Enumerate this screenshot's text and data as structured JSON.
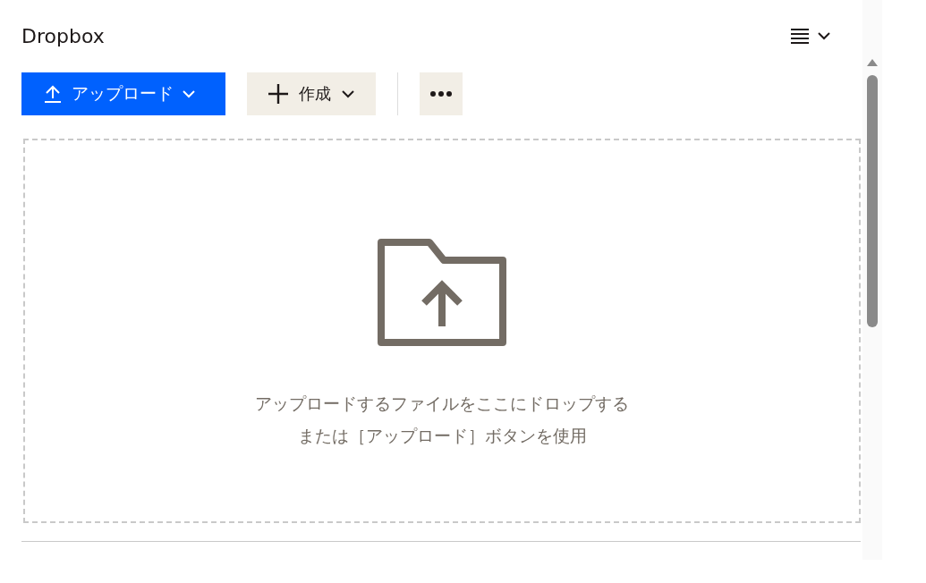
{
  "header": {
    "title": "Dropbox"
  },
  "toolbar": {
    "upload_button": {
      "label": "アップロード"
    },
    "create_button": {
      "label": "作成"
    }
  },
  "dropzone": {
    "lines": [
      "アップロードするファイルをここにドロップする",
      "または［アップロード］ボタンを使用"
    ]
  }
}
